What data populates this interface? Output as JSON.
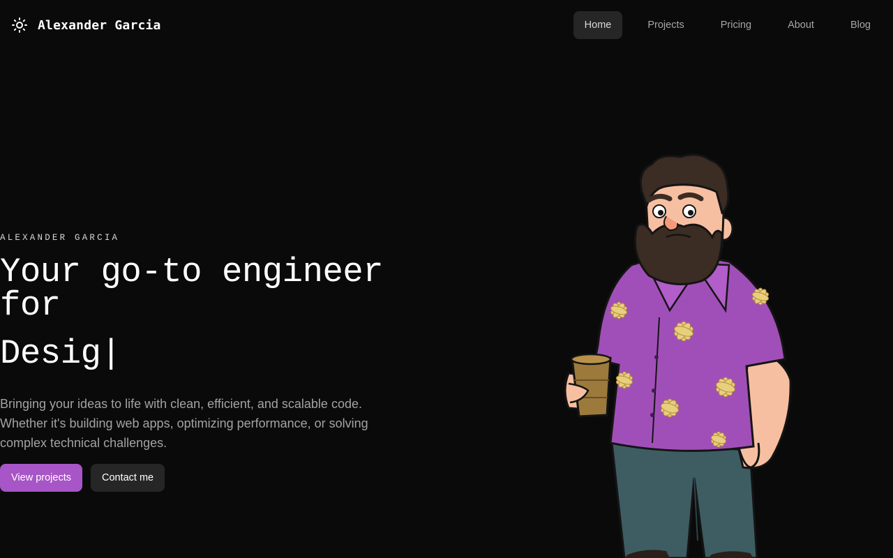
{
  "header": {
    "brand_name": "Alexander Garcia",
    "brand_icon": "sun-icon",
    "nav": [
      {
        "label": "Home",
        "active": true
      },
      {
        "label": "Projects",
        "active": false
      },
      {
        "label": "Pricing",
        "active": false
      },
      {
        "label": "About",
        "active": false
      },
      {
        "label": "Blog",
        "active": false
      }
    ]
  },
  "hero": {
    "eyebrow": "ALEXANDER GARCIA",
    "headline": "Your go-to engineer for",
    "typed_text": "Desig|",
    "description": "Bringing your ideas to life with clean, efficient, and scalable code. Whether it's building web apps, optimizing performance, or solving complex technical challenges.",
    "primary_button": "View projects",
    "secondary_button": "Contact me"
  },
  "colors": {
    "background": "#0a0a0a",
    "accent": "#a855c7",
    "nav_active_bg": "#262626",
    "muted_text": "#a3a3a3"
  }
}
